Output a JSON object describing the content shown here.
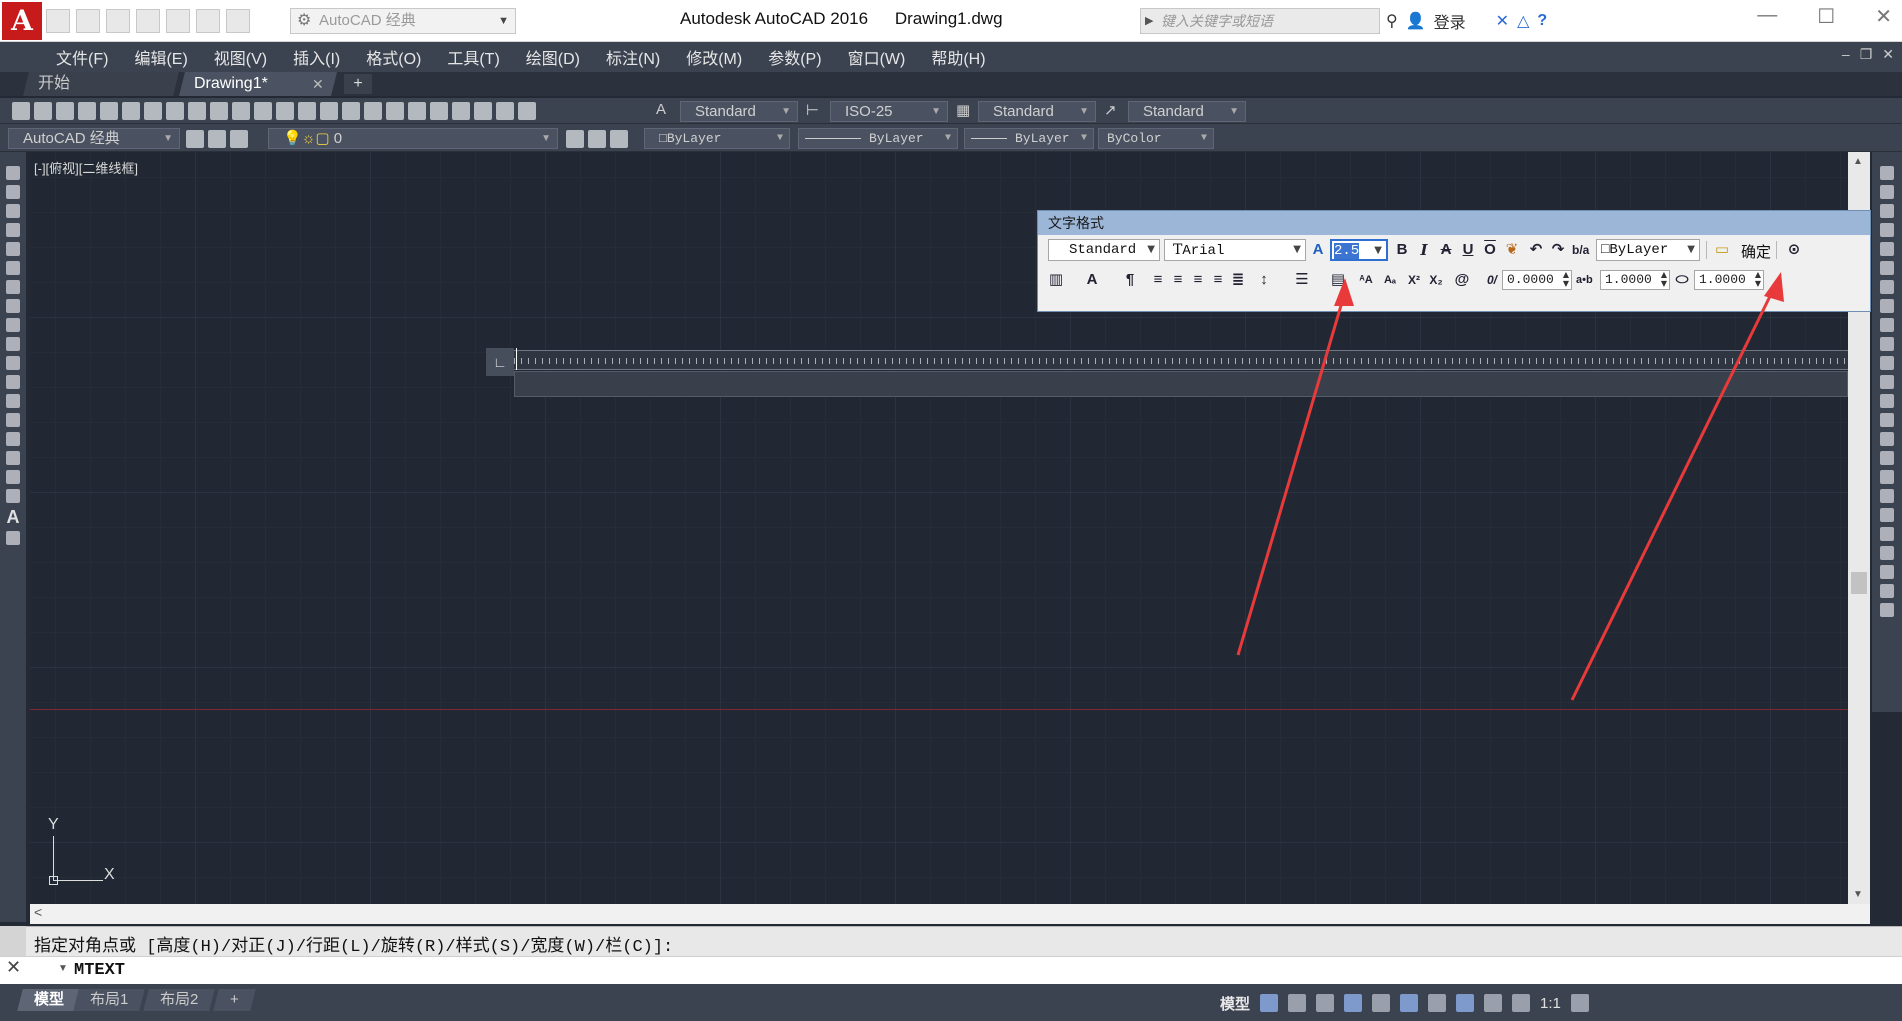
{
  "titlebar": {
    "logo": "A",
    "workspace": "AutoCAD 经典",
    "app_title": "Autodesk AutoCAD 2016",
    "doc_title": "Drawing1.dwg",
    "search_placeholder": "键入关键字或短语",
    "login": "登录"
  },
  "menu": [
    "文件(F)",
    "编辑(E)",
    "视图(V)",
    "插入(I)",
    "格式(O)",
    "工具(T)",
    "绘图(D)",
    "标注(N)",
    "修改(M)",
    "参数(P)",
    "窗口(W)",
    "帮助(H)"
  ],
  "tabs": [
    {
      "label": "开始"
    },
    {
      "label": "Drawing1*"
    }
  ],
  "toolbar1": {
    "text_style": "Standard",
    "dim_style": "ISO-25",
    "table_style": "Standard",
    "mleader_style": "Standard"
  },
  "toolbar2": {
    "workspace": "AutoCAD 经典",
    "layer": "0",
    "color": "ByLayer",
    "linetype": "ByLayer",
    "lineweight": "ByLayer",
    "plotstyle": "ByColor"
  },
  "viewport_label": "[-][俯视][二维线框]",
  "text_format": {
    "title": "文字格式",
    "style": "Standard",
    "font": "Arial",
    "height": "2.5",
    "color": "ByLayer",
    "ok_label": "确定",
    "oblique": "0.0000",
    "tracking": "1.0000",
    "width": "1.0000"
  },
  "ucs": {
    "x": "X",
    "y": "Y"
  },
  "command": {
    "history": "指定对角点或 [高度(H)/对正(J)/行距(L)/旋转(R)/样式(S)/宽度(W)/栏(C)]:",
    "current": "MTEXT"
  },
  "layout_tabs": [
    "模型",
    "布局1",
    "布局2"
  ],
  "status": {
    "model": "模型",
    "scale": "1:1"
  },
  "colors": {
    "accent": "#3b74d1",
    "drawing_bg": "#212833",
    "annotation_arrow": "#e83a3a"
  }
}
